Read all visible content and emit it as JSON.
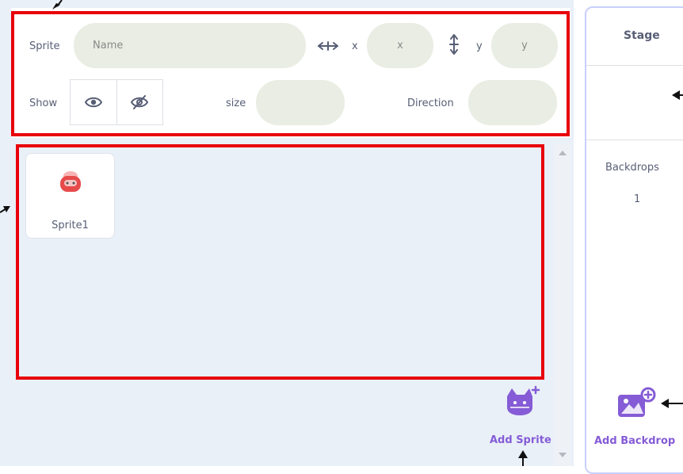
{
  "sprite_info": {
    "sprite_label": "Sprite",
    "name_placeholder": "Name",
    "x_label": "x",
    "x_placeholder": "x",
    "y_label": "y",
    "y_placeholder": "y",
    "show_label": "Show",
    "size_label": "size",
    "size_value": "",
    "direction_label": "Direction",
    "direction_value": ""
  },
  "sprites": [
    {
      "name": "Sprite1"
    }
  ],
  "add_sprite": {
    "label": "Add Sprite"
  },
  "stage": {
    "title": "Stage",
    "backdrops_label": "Backdrops",
    "backdrops_count": "1",
    "add_backdrop_label": "Add Backdrop"
  },
  "colors": {
    "highlight_border": "#e8000b",
    "accent": "#855cd6",
    "field_fill": "#e9ede3",
    "sprite_red": "#e64a4a"
  },
  "icons": [
    "x-position-icon",
    "y-position-icon",
    "eye-visible-icon",
    "eye-hidden-icon",
    "sprite-costume-icon",
    "add-sprite-cat-icon",
    "add-backdrop-icon",
    "scroll-up-arrow-icon",
    "scroll-down-arrow-icon"
  ]
}
